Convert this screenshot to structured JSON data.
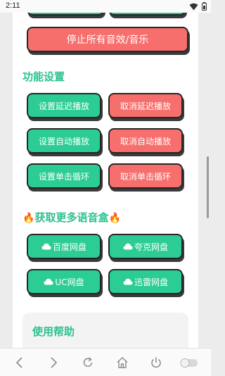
{
  "status_bar": {
    "time": "2:11"
  },
  "buttons": {
    "stop_all": "停止所有音效/音乐"
  },
  "section_settings": {
    "title": "功能设置",
    "buttons": [
      {
        "label": "设置延迟播放",
        "color": "#2ccd94"
      },
      {
        "label": "取消延迟播放",
        "color": "#f66f6d"
      },
      {
        "label": "设置自动播放",
        "color": "#2ccd94"
      },
      {
        "label": "取消自动播放",
        "color": "#f66f6d"
      },
      {
        "label": "设置单击循环",
        "color": "#2ccd94"
      },
      {
        "label": "取消单击循环",
        "color": "#f66f6d"
      }
    ]
  },
  "section_more": {
    "title": "获取更多语音盒",
    "title_icon": "fire-emoji",
    "buttons": [
      {
        "label": "百度网盘",
        "icon": "cloud-icon"
      },
      {
        "label": "夸克网盘",
        "icon": "cloud-icon"
      },
      {
        "label": "UC网盘",
        "icon": "cloud-icon"
      },
      {
        "label": "迅雷网盘",
        "icon": "cloud-icon"
      }
    ]
  },
  "help": {
    "title": "使用帮助"
  },
  "colors": {
    "accent_green": "#2ccd94",
    "accent_red": "#f66f6d",
    "title_green": "#2bc28c"
  },
  "bottom_nav": [
    "back-arrow-icon",
    "forward-arrow-icon",
    "refresh-icon",
    "home-icon",
    "power-icon",
    "toggle-icon"
  ]
}
